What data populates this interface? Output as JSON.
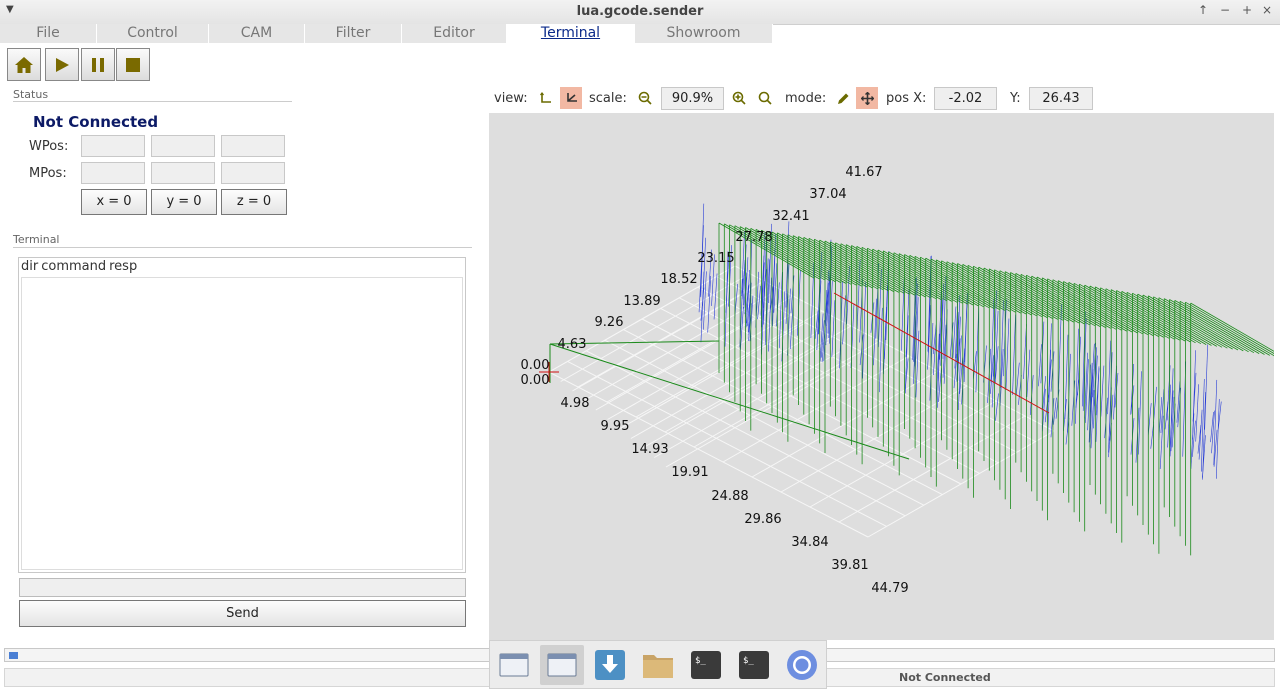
{
  "window": {
    "title": "lua.gcode.sender",
    "controls": [
      "↑",
      "−",
      "+",
      "×"
    ]
  },
  "tabs": [
    {
      "label": "File",
      "active": false
    },
    {
      "label": "Control",
      "active": false
    },
    {
      "label": "CAM",
      "active": false
    },
    {
      "label": "Filter",
      "active": false
    },
    {
      "label": "Editor",
      "active": false
    },
    {
      "label": "Terminal",
      "active": true
    },
    {
      "label": "Showroom",
      "active": false
    }
  ],
  "toolbar": {
    "buttons": [
      {
        "name": "home-icon"
      },
      {
        "name": "play-icon"
      },
      {
        "name": "pause-icon"
      },
      {
        "name": "stop-icon"
      }
    ],
    "icon_color": "#7a6a00"
  },
  "status": {
    "section_label": "Status",
    "connection": "Not Connected",
    "wpos_label": "WPos:",
    "mpos_label": "MPos:",
    "wpos_values": [
      "",
      "",
      ""
    ],
    "mpos_values": [
      "",
      "",
      ""
    ],
    "zero_buttons": [
      "x = 0",
      "y = 0",
      "z = 0"
    ]
  },
  "terminal": {
    "section_label": "Terminal",
    "columns": [
      "dir",
      "command",
      "resp"
    ],
    "input_value": "",
    "send_label": "Send"
  },
  "view_controls": {
    "view_label": "view:",
    "scale_label": "scale:",
    "scale_value": "90.9%",
    "mode_label": "mode:",
    "posx_label": "pos X:",
    "posx_value": "-2.02",
    "y_label": "Y:",
    "y_value": "26.43"
  },
  "viewport": {
    "background": "#dedede",
    "axis_labels_z": [
      "41.67",
      "37.04",
      "32.41",
      "27.78",
      "23.15",
      "18.52",
      "13.89",
      "9.26",
      "4.63",
      "0.00"
    ],
    "axis_labels_y": [
      "0.00",
      "4.98",
      "9.95",
      "14.93",
      "19.91",
      "24.88",
      "29.86",
      "34.84",
      "39.81",
      "44.79"
    ],
    "toolpath_colors": {
      "travel": "#1a8a1a",
      "cut": "#2a3fd6",
      "current": "#d01010"
    }
  },
  "progress": {
    "fraction": 0.007
  },
  "status_bar": {
    "text": "Not Connected"
  },
  "taskbar": {
    "items": [
      {
        "name": "window-icon",
        "active": false
      },
      {
        "name": "window-icon",
        "active": true
      },
      {
        "name": "download-icon",
        "active": false
      },
      {
        "name": "folder-icon",
        "active": false
      },
      {
        "name": "terminal-icon",
        "active": false
      },
      {
        "name": "terminal-icon",
        "active": false
      },
      {
        "name": "browser-icon",
        "active": false
      }
    ]
  }
}
